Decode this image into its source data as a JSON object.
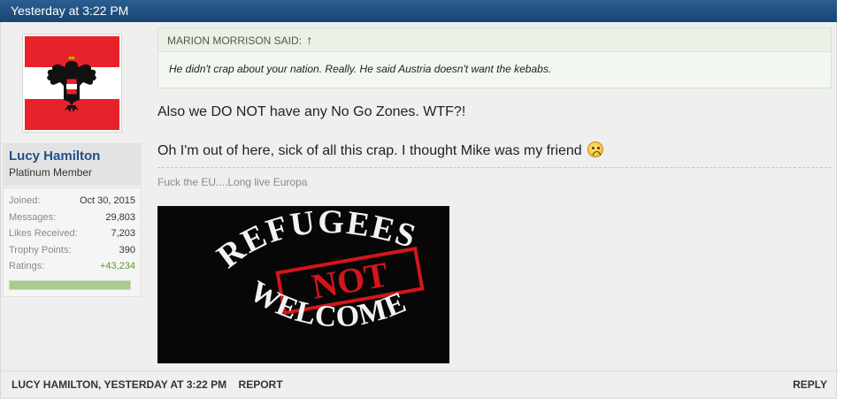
{
  "post": {
    "date": "Yesterday at 3:22 PM"
  },
  "user": {
    "name": "Lucy Hamilton",
    "title": "Platinum Member",
    "stats": [
      {
        "label": "Joined:",
        "value": "Oct 30, 2015"
      },
      {
        "label": "Messages:",
        "value": "29,803"
      },
      {
        "label": "Likes Received:",
        "value": "7,203"
      },
      {
        "label": "Trophy Points:",
        "value": "390"
      },
      {
        "label": "Ratings:",
        "value": "+43,234"
      }
    ],
    "rating_fill": 1.0,
    "rating_color": "#a7cc8c"
  },
  "quote": {
    "author_line": "MARION MORRISON SAID:",
    "arrow_icon": "up-arrow-icon",
    "text": "He didn't crap about your nation. Really. He said Austria doesn't want the kebabs."
  },
  "message": {
    "line1": "Also we DO NOT have any No Go Zones. WTF?!",
    "line2": "Oh I'm out of here, sick of all this crap. I thought Mike was my friend",
    "emoji_icon": "frowning-face-emoji"
  },
  "signature": {
    "text": "Fuck the EU....Long live Europa",
    "image_text_top": "REFUGEES",
    "image_text_middle": "NOT",
    "image_text_bottom": "WELCOME"
  },
  "footer": {
    "author": "Lucy Hamilton",
    "separator": ",",
    "time": "Yesterday at 3:22 PM",
    "report": "Report",
    "reply": "REPLY"
  },
  "colors": {
    "header_bar": "#1f4f80",
    "username": "#1f4f8c",
    "positive_rating": "#5a9a2a"
  }
}
